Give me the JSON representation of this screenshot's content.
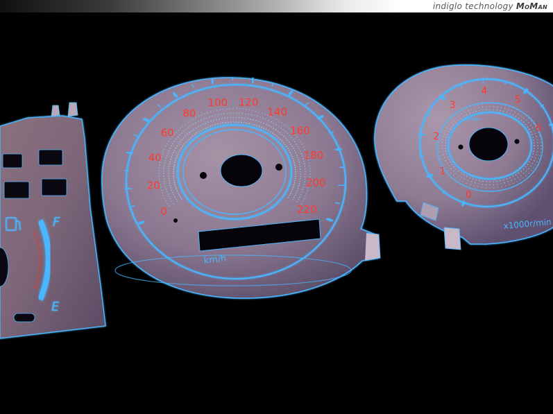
{
  "banner": {
    "text": "indiglo technology",
    "brand": "MoMan"
  },
  "speedometer": {
    "labels": [
      "0",
      "20",
      "40",
      "60",
      "80",
      "100",
      "120",
      "140",
      "160",
      "180",
      "200",
      "220"
    ],
    "unit": "km/h"
  },
  "tachometer": {
    "labels": [
      "0",
      "1",
      "2",
      "3",
      "4",
      "5",
      "6"
    ],
    "unit": "x1000r/min",
    "brand": "MoMan"
  },
  "fuel_gauge": {
    "full": "F",
    "empty": "E"
  },
  "colors": {
    "glow": "#4ab6ff",
    "numerals": "#ff3a2a",
    "face": "#8f7e93"
  }
}
